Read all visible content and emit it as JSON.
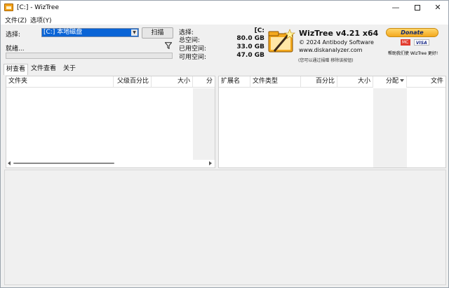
{
  "window": {
    "title": "[C:]  - WizTree",
    "minimize": "—",
    "close": "✕"
  },
  "menu": {
    "file": "文件(Z)",
    "options": "选项(Y)"
  },
  "scan_panel": {
    "select_label": "选择:",
    "drive_value": "[C:] 本地磁盘",
    "scan_button": "扫描",
    "status": "就绪...",
    "filter_icon": "filter-icon"
  },
  "stats": {
    "select_label": "选择:",
    "select_value": "[C:",
    "total_label": "总空间:",
    "total_value": "80.0 GB",
    "used_label": "已用空间:",
    "used_value": "33.0 GB",
    "free_label": "可用空间:",
    "free_value": "47.0 GB"
  },
  "about": {
    "product": "WizTree v4.21 x64",
    "copyright": "© 2024 Antibody Software",
    "website": "www.diskanalyzer.com",
    "hint": "(您可以通过捐赠 移除该按钮)"
  },
  "donate": {
    "button": "Donate",
    "card1": "MC",
    "card2": "VISA",
    "note": "帮助我们使 WizTree 更好!"
  },
  "tabs": [
    {
      "label": "树查看",
      "active": true
    },
    {
      "label": "文件查看",
      "active": false
    },
    {
      "label": "关于",
      "active": false
    }
  ],
  "folder_table": {
    "columns": [
      "文件夹",
      "父级百分比",
      "大小",
      "分"
    ]
  },
  "ext_table": {
    "columns": [
      "扩展名",
      "文件类型",
      "百分比",
      "大小",
      "分配",
      "文件"
    ],
    "sorted_column": "分配"
  },
  "colors": {
    "selection": "#0a64d6",
    "donate_gold": "#f3a81d"
  }
}
